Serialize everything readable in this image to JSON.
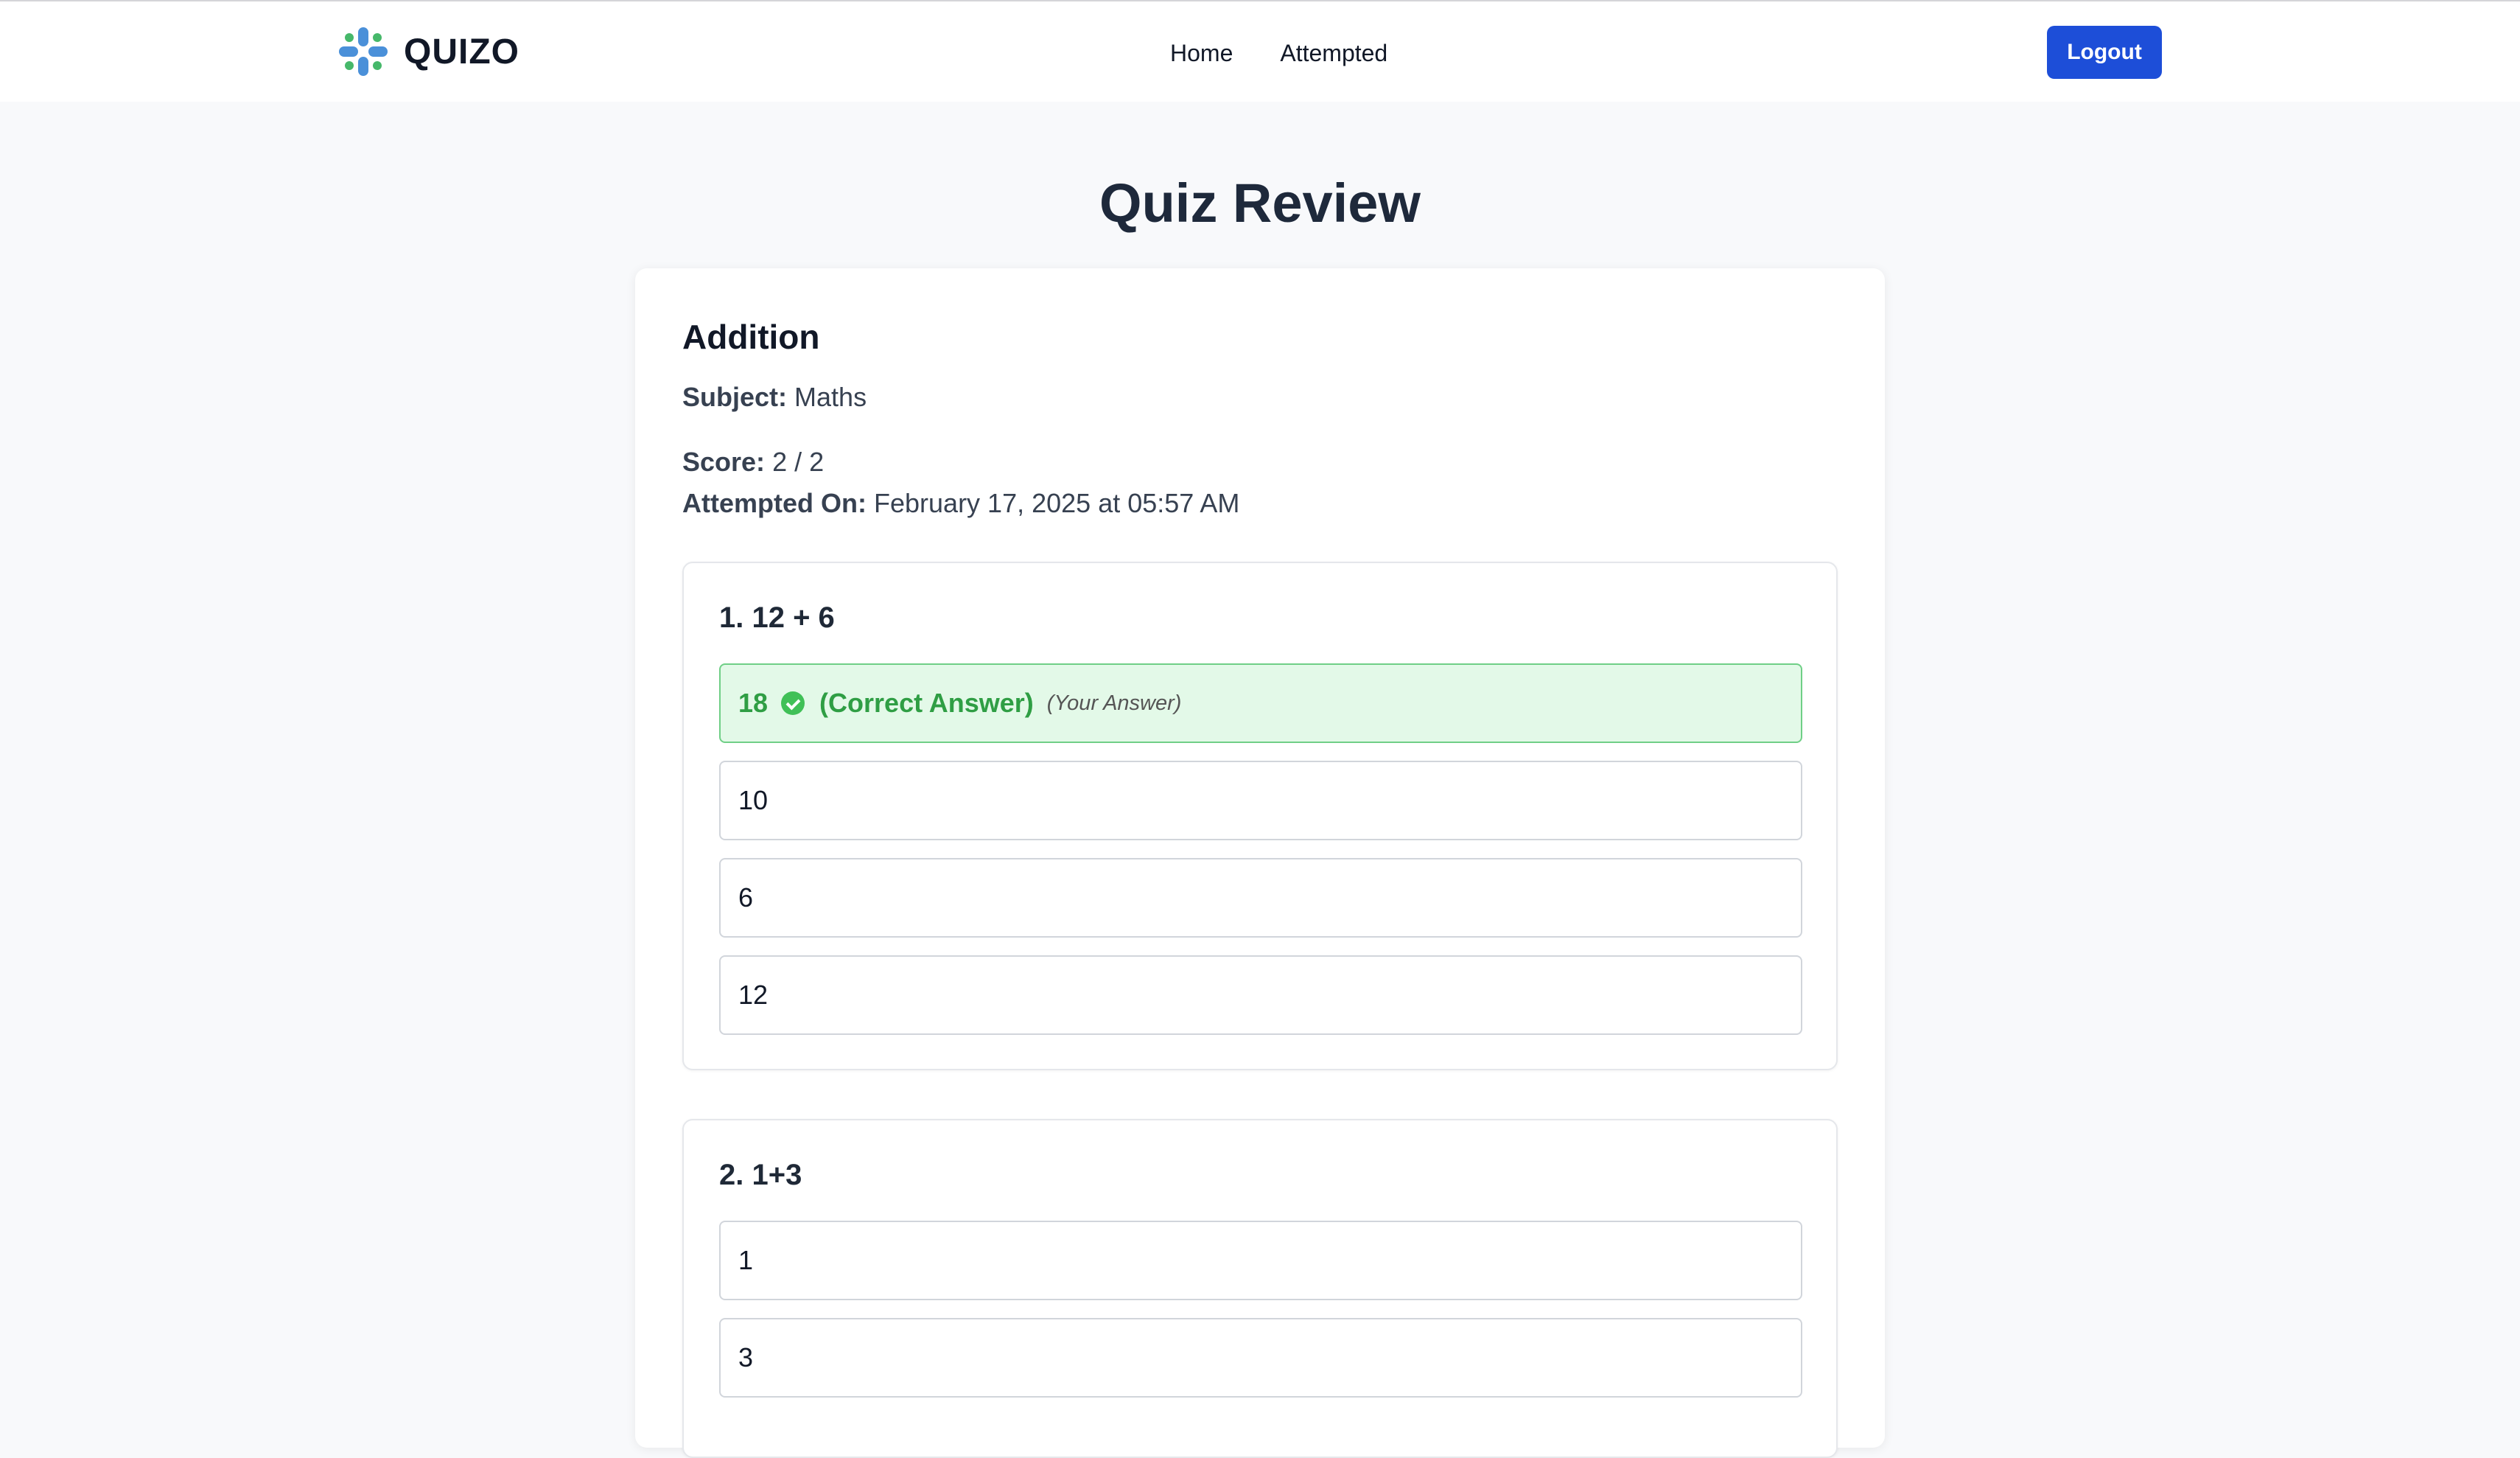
{
  "app": {
    "brand": "QUIZO"
  },
  "nav": {
    "items": [
      "Home",
      "Attempted"
    ],
    "logout_label": "Logout"
  },
  "page": {
    "title": "Quiz Review"
  },
  "quiz": {
    "title": "Addition",
    "subject_label": "Subject:",
    "subject": "Maths",
    "score_label": "Score:",
    "score": "2 / 2",
    "attempted_label": "Attempted On:",
    "attempted_on": "February 17, 2025 at 05:57 AM"
  },
  "questions": [
    {
      "title": "1. 12 + 6",
      "options": [
        {
          "text": "18",
          "correct": true,
          "correct_text": "(Correct Answer)",
          "your_answer_text": "(Your Answer)"
        },
        {
          "text": "10"
        },
        {
          "text": "6"
        },
        {
          "text": "12"
        }
      ]
    },
    {
      "title": "2. 1+3",
      "options": [
        {
          "text": "1"
        },
        {
          "text": "3"
        }
      ]
    }
  ],
  "colors": {
    "primary_button": "#1d4ed8",
    "correct_bg": "#e3f9e8",
    "correct_text": "#2f9e44",
    "logo_blue": "#4a90d9",
    "logo_green": "#46b86a"
  },
  "icons": {
    "logo": "quizo-logo-icon",
    "correct": "check-circle-icon"
  }
}
